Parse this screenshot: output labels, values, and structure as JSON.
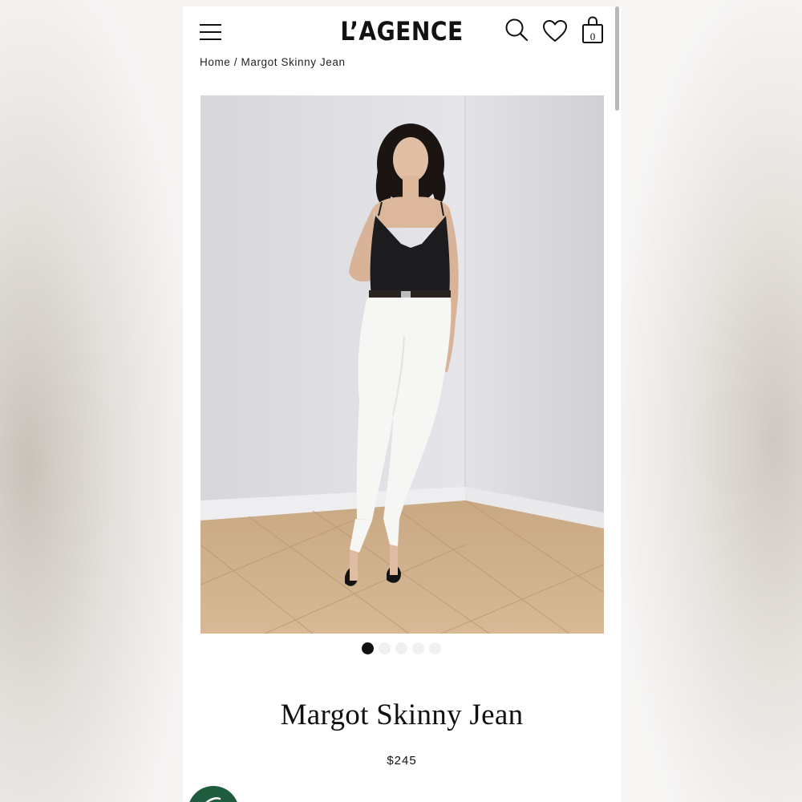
{
  "header": {
    "logo": "L’AGENCE",
    "cart_count": "0"
  },
  "breadcrumb": {
    "home": "Home",
    "separator": "/",
    "current": "Margot Skinny Jean"
  },
  "gallery": {
    "total_images": 5,
    "active_index": 0
  },
  "product": {
    "name": "Margot Skinny Jean",
    "price": "$245"
  },
  "colors": {
    "chat_button": "#1f5c3e",
    "text": "#111111"
  },
  "icons": [
    "menu-icon",
    "search-icon",
    "heart-icon",
    "shopping-bag-icon",
    "chat-icon"
  ]
}
